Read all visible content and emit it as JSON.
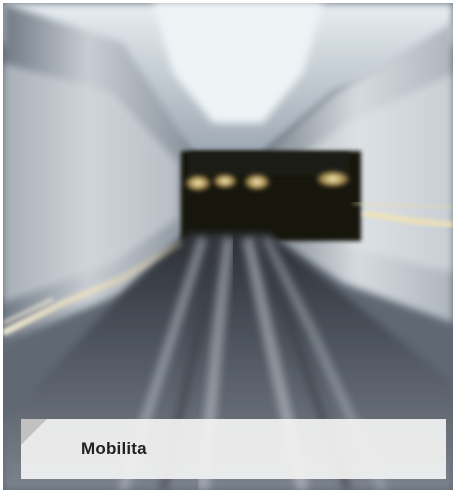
{
  "caption": {
    "label": "Mobilita"
  },
  "photo": {
    "subject": "tunnel-motion-blur",
    "colors": {
      "light": "#f2f2f2",
      "tunnel_dark": "#141210",
      "lamp": "#f6dc9a",
      "wall_light": "#d9dde2",
      "floor": "#5d6470"
    }
  }
}
